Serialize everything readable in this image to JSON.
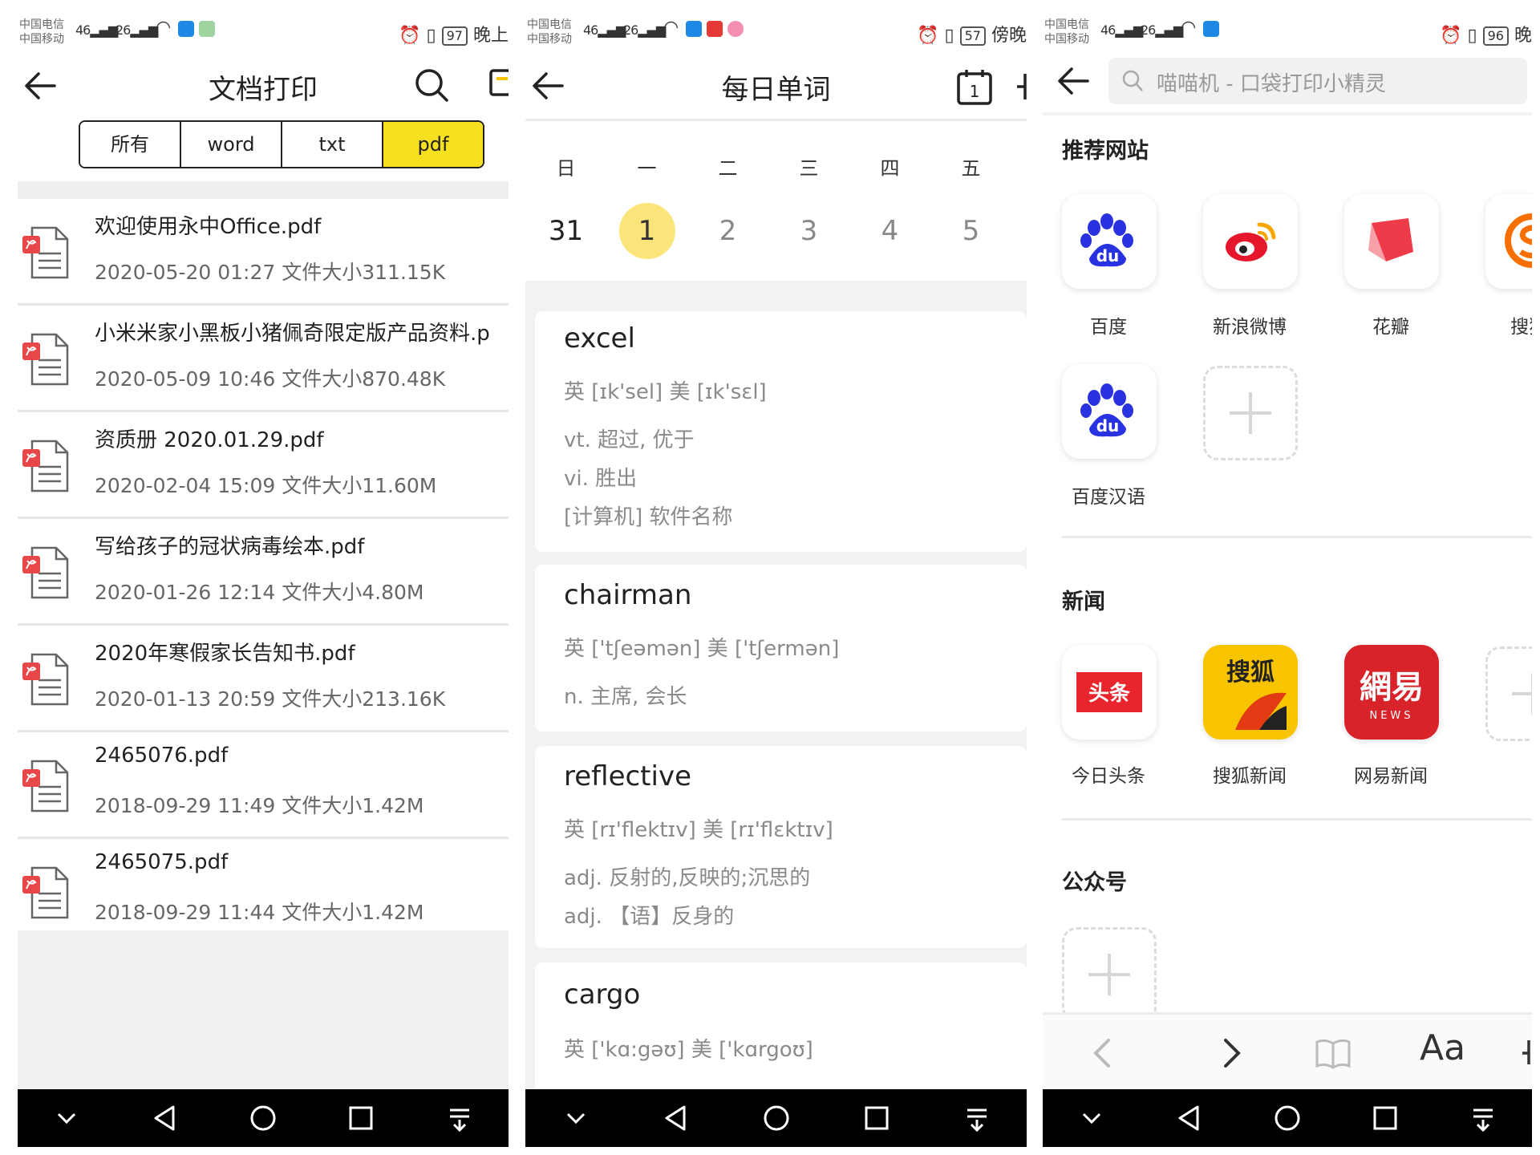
{
  "screens": {
    "doc_print": {
      "status": {
        "carrier1": "中国电信",
        "carrier2": "中国移动",
        "net1": "46",
        "net2": "26",
        "battery": "97",
        "time": "晚上"
      },
      "title": "文档打印",
      "tabs": [
        "所有",
        "word",
        "txt",
        "pdf"
      ],
      "active_tab": "pdf",
      "files": [
        {
          "name": "欢迎使用永中Office.pdf",
          "date": "2020-05-20 01:27",
          "size": "文件大小311.15K"
        },
        {
          "name": "小米米家小黑板小猪佩奇限定版产品资料.p",
          "date": "2020-05-09 10:46",
          "size": "文件大小870.48K"
        },
        {
          "name": "资质册 2020.01.29.pdf",
          "date": "2020-02-04 15:09",
          "size": "文件大小11.60M"
        },
        {
          "name": "写给孩子的冠状病毒绘本.pdf",
          "date": "2020-01-26 12:14",
          "size": "文件大小4.80M"
        },
        {
          "name": "2020年寒假家长告知书.pdf",
          "date": "2020-01-13 20:59",
          "size": "文件大小213.16K"
        },
        {
          "name": "2465076.pdf",
          "date": "2018-09-29 11:49",
          "size": "文件大小1.42M"
        },
        {
          "name": "2465075.pdf",
          "date": "2018-09-29 11:44",
          "size": "文件大小1.42M"
        }
      ]
    },
    "daily_words": {
      "status": {
        "carrier1": "中国电信",
        "carrier2": "中国移动",
        "net1": "46",
        "net2": "26",
        "battery": "57",
        "time": "傍晚"
      },
      "title": "每日单词",
      "calendar_icon_text": "1",
      "weekdays": [
        "日",
        "一",
        "二",
        "三",
        "四",
        "五"
      ],
      "dates": [
        "31",
        "1",
        "2",
        "3",
        "4",
        "5"
      ],
      "selected_date": "1",
      "words": [
        {
          "word": "excel",
          "phonetic": "英 [ɪk'sel]  美 [ɪk'sɛl]",
          "defs": [
            "vt. 超过, 优于",
            "vi. 胜出",
            "[计算机] 软件名称"
          ]
        },
        {
          "word": "chairman",
          "phonetic": "英 ['tʃeəmən]  美 ['tʃermən]",
          "defs": [
            "n. 主席, 会长"
          ]
        },
        {
          "word": "reflective",
          "phonetic": "英 [rɪ'flektɪv]  美 [rɪ'flɛktɪv]",
          "defs": [
            "adj. 反射的,反映的;沉思的",
            "adj. 【语】反身的"
          ]
        },
        {
          "word": "cargo",
          "phonetic": "英 ['kɑ:gəʊ]  美 ['kɑrgoʊ]",
          "defs": []
        }
      ]
    },
    "browser": {
      "status": {
        "carrier1": "中国电信",
        "carrier2": "中国移动",
        "net1": "46",
        "net2": "26",
        "battery": "96",
        "time": "晚"
      },
      "search_placeholder": "喵喵机 - 口袋打印小精灵",
      "sections": {
        "recommended": "推荐网站",
        "news": "新闻",
        "official": "公众号"
      },
      "recommended_sites": [
        "百度",
        "新浪微博",
        "花瓣",
        "搜狗|",
        "百度汉语"
      ],
      "news_sites": [
        "今日头条",
        "搜狐新闻",
        "网易新闻"
      ],
      "toutiao_logo": "头条",
      "sohu_logo": "搜狐",
      "netease_logo": "網易",
      "netease_sub": "NEWS",
      "font_button": "Aa",
      "colors": {
        "accent_yellow": "#f7e020",
        "today_circle": "#fbe57a",
        "baidu_blue": "#2932e1",
        "weibo_red": "#e6162d",
        "toutiao_red": "#e8252c",
        "netease_red": "#d8232a",
        "sohu_yellow": "#f8c400"
      }
    }
  }
}
